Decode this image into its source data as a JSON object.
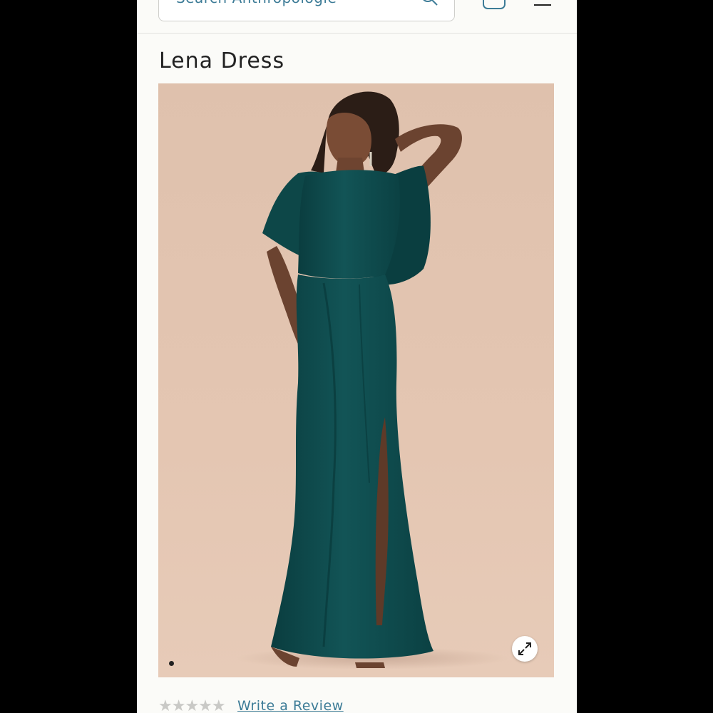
{
  "header": {
    "search": {
      "placeholder": "Search Anthropologie"
    }
  },
  "product": {
    "title": "Lena Dress",
    "image": {
      "slide_count": 1,
      "active_slide": 1
    }
  },
  "reviews": {
    "stars": "★★★★★",
    "write_review_label": "Write a Review"
  },
  "icons": {
    "search": "search-icon",
    "cart": "cart-icon",
    "menu": "menu-icon",
    "expand": "expand-icon",
    "star": "star-icon"
  },
  "colors": {
    "accent": "#3d7c97",
    "dress": "#0f4a4b",
    "backdrop": "#e2c4b0",
    "page_background": "#fbfbf8"
  }
}
